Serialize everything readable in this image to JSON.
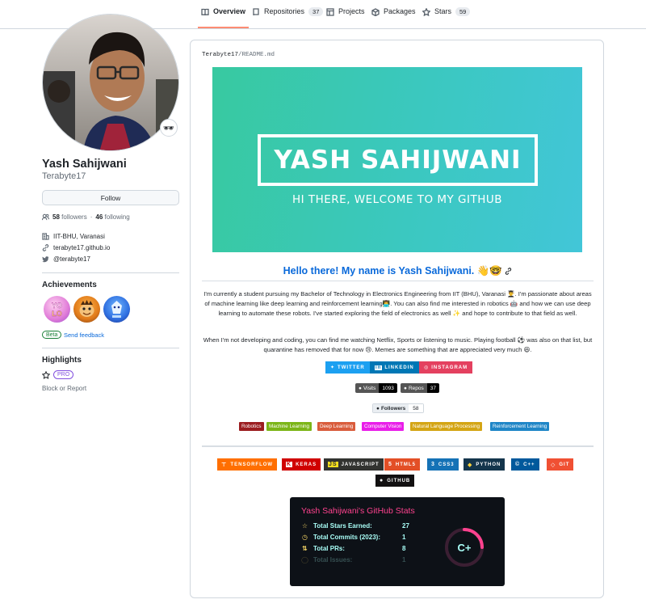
{
  "tabs": [
    {
      "label": "Overview",
      "count": null,
      "icon": "book-icon",
      "active": true
    },
    {
      "label": "Repositories",
      "count": "37",
      "icon": "repo-icon"
    },
    {
      "label": "Projects",
      "count": null,
      "icon": "table-icon"
    },
    {
      "label": "Packages",
      "count": null,
      "icon": "package-icon"
    },
    {
      "label": "Stars",
      "count": "59",
      "icon": "star-icon"
    }
  ],
  "profile": {
    "name": "Yash Sahijwani",
    "login": "Terabyte17",
    "status_emoji": "🕶",
    "follow_label": "Follow",
    "followers_count": "58",
    "followers_label": "followers",
    "following_count": "46",
    "following_label": "following",
    "dot": "·",
    "organization": "IIT-BHU, Varanasi",
    "website": "terabyte17.github.io",
    "twitter": "@terabyte17"
  },
  "achievements": {
    "heading": "Achievements",
    "badges": [
      "yolo",
      "pull-shark",
      "arctic-code-vault"
    ],
    "beta_label": "Beta",
    "feedback_label": "Send feedback"
  },
  "highlights": {
    "heading": "Highlights",
    "pro_label": "PRO",
    "block_label": "Block or Report"
  },
  "readme": {
    "owner": "Terabyte17",
    "sep": "/",
    "file": "README.md",
    "banner_title": "YASH SAHIJWANI",
    "banner_subtitle": "HI THERE, WELCOME TO MY GITHUB",
    "hello": "Hello there! My name is Yash Sahijwani. 👋🤓",
    "para1": "I'm currently a student pursuing my Bachelor of Technology in Electronics Engineering from IIT (BHU), Varanasi 👨‍🎓. I'm passionate about areas of machine learning like deep learning and reinforcement learning👨‍💻. You can also find me interested in robotics 🤖 and how we can use deep learning to automate these robots. I've started exploring the field of electronics as well ✨ and hope to contribute to that field as well.",
    "para2": "When I'm not developing and coding, you can find me watching Netflix, Sports or listening to music. Playing football ⚽ was also on that list, but quarantine has removed that for now 😢. Memes are something that are appreciated very much 😆.",
    "social": [
      {
        "label": "TWITTER",
        "color": "#1ca0f1",
        "icon": "twitter-icon"
      },
      {
        "label": "LINKEDIN",
        "color": "#0077b5",
        "icon": "linkedin-icon"
      },
      {
        "label": "INSTAGRAM",
        "color": "#e4405f",
        "icon": "instagram-icon"
      }
    ],
    "visits_label": "Visits",
    "visits_value": "1093",
    "repos_label": "Repos",
    "repos_value": "37",
    "followers_label": "Followers",
    "followers_value": "58",
    "topics": [
      {
        "label": "Robotics",
        "color": "#9b1d20"
      },
      {
        "label": "Machine Learning",
        "color": "#7cb518"
      },
      {
        "label": "Deep Learning",
        "color": "#d95c3c"
      },
      {
        "label": "Computer Vision",
        "color": "#e91ee9"
      },
      {
        "label": "Natural Language Processing",
        "color": "#d4a514"
      },
      {
        "label": "Reinforcement Learning",
        "color": "#1f86c7"
      }
    ],
    "tech": [
      {
        "label": "TENSORFLOW",
        "color": "#ff6f00",
        "icon": "tensorflow-icon"
      },
      {
        "label": "KERAS",
        "color": "#d00000",
        "icon": "keras-icon"
      },
      {
        "label": "JAVASCRIPT",
        "color": "#323330",
        "icon": "javascript-icon"
      },
      {
        "label": "HTML5",
        "color": "#e34f26",
        "icon": "html5-icon"
      },
      {
        "label": "CSS3",
        "color": "#1572b6",
        "icon": "css3-icon"
      },
      {
        "label": "PYTHON",
        "color": "#14354c",
        "icon": "python-icon"
      },
      {
        "label": "C++",
        "color": "#00599c",
        "icon": "cplusplus-icon"
      },
      {
        "label": "GIT",
        "color": "#f05033",
        "icon": "git-icon"
      },
      {
        "label": "GITHUB",
        "color": "#121011",
        "icon": "github-icon"
      }
    ],
    "stats": {
      "title": "Yash Sahijwani's GitHub Stats",
      "rows": [
        {
          "label": "Total Stars Earned:",
          "value": "27",
          "icon": "star-icon"
        },
        {
          "label": "Total Commits (2023):",
          "value": "1",
          "icon": "history-icon"
        },
        {
          "label": "Total PRs:",
          "value": "8",
          "icon": "pull-request-icon"
        },
        {
          "label": "Total Issues:",
          "value": "1",
          "icon": "issue-icon"
        }
      ],
      "rank": "C+",
      "rank_progress": 0.25,
      "title_color": "#fe428e",
      "text_color": "#a9fef7",
      "icon_color": "#f8d866"
    }
  }
}
